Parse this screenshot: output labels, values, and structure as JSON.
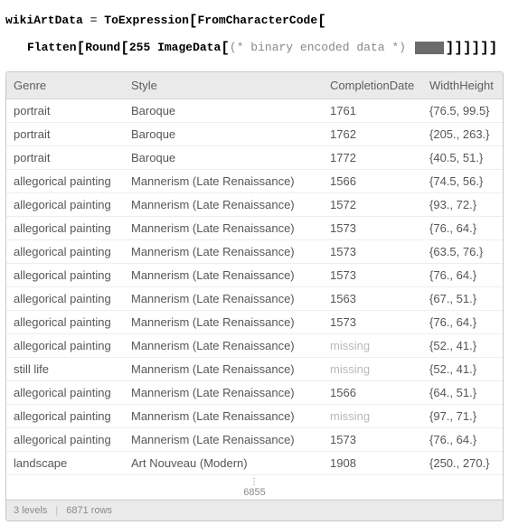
{
  "code": {
    "lhs": "wikiArtData",
    "eq": "=",
    "fn_toexpr": "ToExpression",
    "fn_fromcc": "FromCharacterCode",
    "fn_flatten": "Flatten",
    "fn_round": "Round",
    "num_255": "255",
    "fn_imagedata": "ImageData",
    "comment": "(* binary encoded data *)"
  },
  "headers": {
    "genre": "Genre",
    "style": "Style",
    "date": "CompletionDate",
    "wh": "WidthHeight"
  },
  "rows": [
    {
      "genre": "portrait",
      "style": "Baroque",
      "date": "1761",
      "wh": "{76.5, 99.5}"
    },
    {
      "genre": "portrait",
      "style": "Baroque",
      "date": "1762",
      "wh": "{205., 263.}"
    },
    {
      "genre": "portrait",
      "style": "Baroque",
      "date": "1772",
      "wh": "{40.5, 51.}"
    },
    {
      "genre": "allegorical painting",
      "style": "Mannerism (Late Renaissance)",
      "date": "1566",
      "wh": "{74.5, 56.}"
    },
    {
      "genre": "allegorical painting",
      "style": "Mannerism (Late Renaissance)",
      "date": "1572",
      "wh": "{93., 72.}"
    },
    {
      "genre": "allegorical painting",
      "style": "Mannerism (Late Renaissance)",
      "date": "1573",
      "wh": "{76., 64.}"
    },
    {
      "genre": "allegorical painting",
      "style": "Mannerism (Late Renaissance)",
      "date": "1573",
      "wh": "{63.5, 76.}"
    },
    {
      "genre": "allegorical painting",
      "style": "Mannerism (Late Renaissance)",
      "date": "1573",
      "wh": "{76., 64.}"
    },
    {
      "genre": "allegorical painting",
      "style": "Mannerism (Late Renaissance)",
      "date": "1563",
      "wh": "{67., 51.}"
    },
    {
      "genre": "allegorical painting",
      "style": "Mannerism (Late Renaissance)",
      "date": "1573",
      "wh": "{76., 64.}"
    },
    {
      "genre": "allegorical painting",
      "style": "Mannerism (Late Renaissance)",
      "date": "missing",
      "wh": "{52., 41.}"
    },
    {
      "genre": "still life",
      "style": "Mannerism (Late Renaissance)",
      "date": "missing",
      "wh": "{52., 41.}"
    },
    {
      "genre": "allegorical painting",
      "style": "Mannerism (Late Renaissance)",
      "date": "1566",
      "wh": "{64., 51.}"
    },
    {
      "genre": "allegorical painting",
      "style": "Mannerism (Late Renaissance)",
      "date": "missing",
      "wh": "{97., 71.}"
    },
    {
      "genre": "allegorical painting",
      "style": "Mannerism (Late Renaissance)",
      "date": "1573",
      "wh": "{76., 64.}"
    },
    {
      "genre": "landscape",
      "style": "Art Nouveau (Modern)",
      "date": "1908",
      "wh": "{250., 270.}"
    }
  ],
  "ellipsis_count": "6855",
  "footer": {
    "levels": "3 levels",
    "rows": "6871 rows"
  },
  "chart_data": {
    "type": "table",
    "title": "wikiArtData",
    "columns": [
      "Genre",
      "Style",
      "CompletionDate",
      "WidthHeight"
    ],
    "total_rows": 6871,
    "visible_rows": 16,
    "hidden_rows_indicator": 6855,
    "data": [
      [
        "portrait",
        "Baroque",
        1761,
        [
          76.5,
          99.5
        ]
      ],
      [
        "portrait",
        "Baroque",
        1762,
        [
          205.0,
          263.0
        ]
      ],
      [
        "portrait",
        "Baroque",
        1772,
        [
          40.5,
          51.0
        ]
      ],
      [
        "allegorical painting",
        "Mannerism (Late Renaissance)",
        1566,
        [
          74.5,
          56.0
        ]
      ],
      [
        "allegorical painting",
        "Mannerism (Late Renaissance)",
        1572,
        [
          93.0,
          72.0
        ]
      ],
      [
        "allegorical painting",
        "Mannerism (Late Renaissance)",
        1573,
        [
          76.0,
          64.0
        ]
      ],
      [
        "allegorical painting",
        "Mannerism (Late Renaissance)",
        1573,
        [
          63.5,
          76.0
        ]
      ],
      [
        "allegorical painting",
        "Mannerism (Late Renaissance)",
        1573,
        [
          76.0,
          64.0
        ]
      ],
      [
        "allegorical painting",
        "Mannerism (Late Renaissance)",
        1563,
        [
          67.0,
          51.0
        ]
      ],
      [
        "allegorical painting",
        "Mannerism (Late Renaissance)",
        1573,
        [
          76.0,
          64.0
        ]
      ],
      [
        "allegorical painting",
        "Mannerism (Late Renaissance)",
        null,
        [
          52.0,
          41.0
        ]
      ],
      [
        "still life",
        "Mannerism (Late Renaissance)",
        null,
        [
          52.0,
          41.0
        ]
      ],
      [
        "allegorical painting",
        "Mannerism (Late Renaissance)",
        1566,
        [
          64.0,
          51.0
        ]
      ],
      [
        "allegorical painting",
        "Mannerism (Late Renaissance)",
        null,
        [
          97.0,
          71.0
        ]
      ],
      [
        "allegorical painting",
        "Mannerism (Late Renaissance)",
        1573,
        [
          76.0,
          64.0
        ]
      ],
      [
        "landscape",
        "Art Nouveau (Modern)",
        1908,
        [
          250.0,
          270.0
        ]
      ]
    ]
  }
}
